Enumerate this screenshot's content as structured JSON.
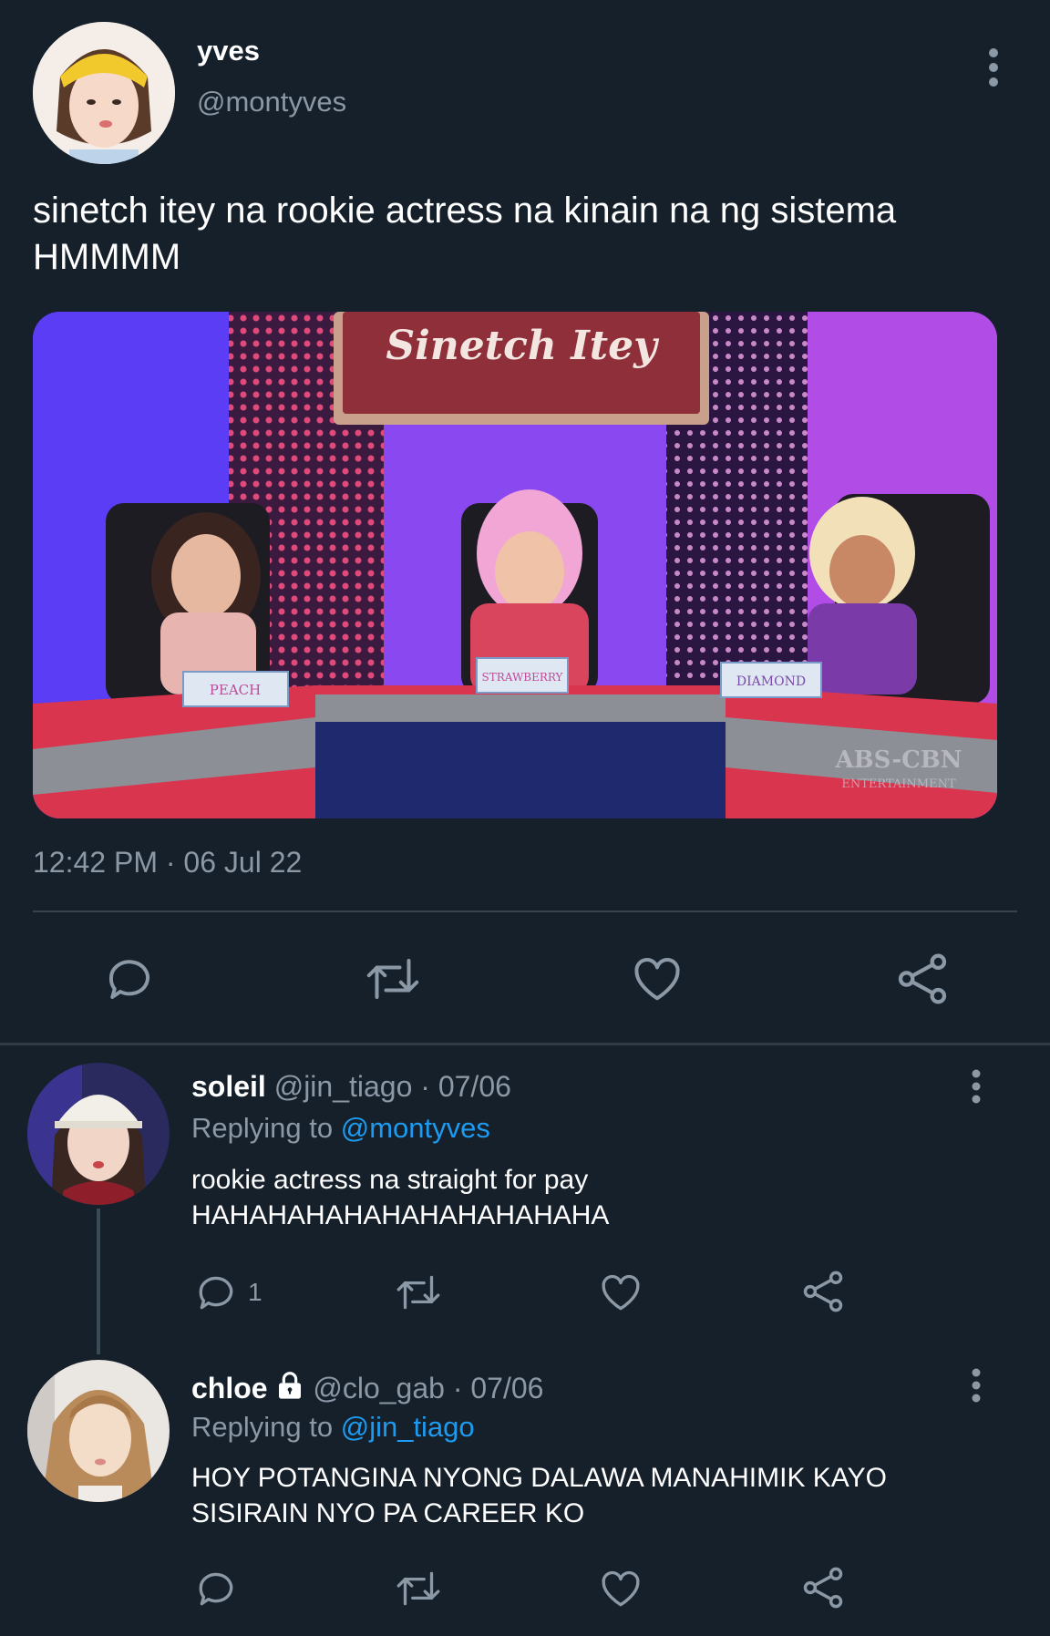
{
  "tweet": {
    "display_name": "yves",
    "handle": "@montyves",
    "text": "sinetch itey na rookie actress na kinain na ng sistema HMMMM",
    "timestamp": "12:42 PM · 06 Jul 22",
    "media": {
      "banner_text": "Sinetch  Itey",
      "nameplates": [
        "PEACH",
        "STRAWBERRY",
        "DIAMOND"
      ],
      "watermark": "ABS-CBN",
      "watermark_sub": "ENTERTAINMENT"
    },
    "actions": [
      "reply-icon",
      "retweet-icon",
      "like-icon",
      "share-icon"
    ]
  },
  "replies": [
    {
      "display_name": "soleil",
      "meta": "@jin_tiago · 07/06",
      "replying_prefix": "Replying to",
      "replying_to": "@montyves",
      "text_lines": [
        "rookie actress na straight for pay",
        "HAHAHAHAHAHAHAHAHAHAHA"
      ],
      "reply_count": "1"
    },
    {
      "display_name": "chloe",
      "locked": true,
      "meta": "@clo_gab · 07/06",
      "replying_prefix": "Replying to",
      "replying_to": "@jin_tiago",
      "text_lines": [
        "HOY POTANGINA NYONG DALAWA MANAHIMIK KAYO",
        "SISIRAIN NYO PA CAREER KO"
      ],
      "reply_count": ""
    }
  ],
  "colors": {
    "background": "#15202b",
    "secondary_text": "#8b98a5",
    "link": "#1d9bf0",
    "divider": "#38444d"
  }
}
